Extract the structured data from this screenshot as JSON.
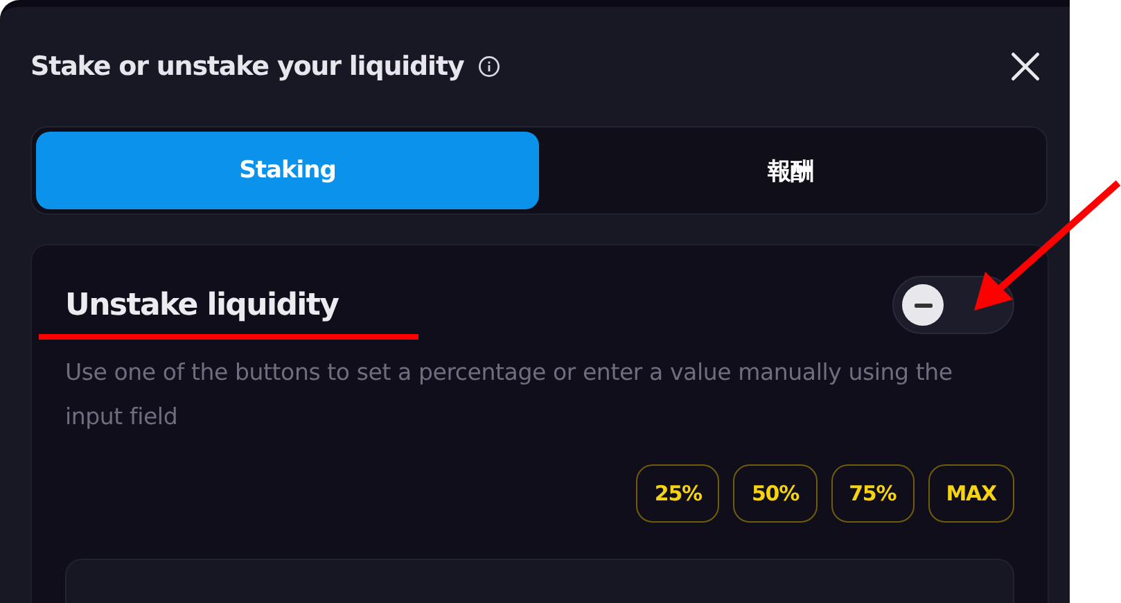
{
  "dialog": {
    "title": "Stake or unstake your liquidity"
  },
  "tabs": [
    {
      "label": "Staking",
      "selected": true
    },
    {
      "label": "報酬",
      "selected": false
    }
  ],
  "section": {
    "title": "Unstake liquidity",
    "toggle": {
      "on": false
    },
    "description": "Use one of the buttons to set a percentage or enter a value manually using the input field"
  },
  "percent_buttons": [
    "25%",
    "50%",
    "75%",
    "MAX"
  ]
}
